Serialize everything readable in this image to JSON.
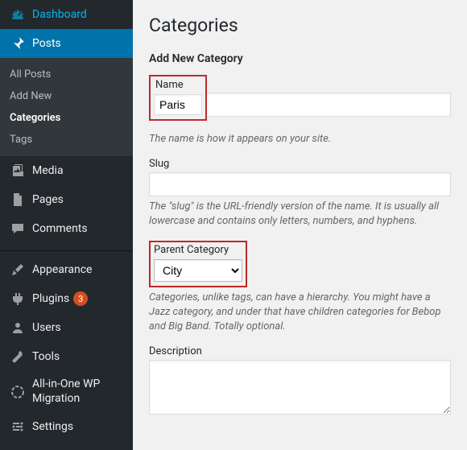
{
  "sidebar": {
    "dashboard": "Dashboard",
    "posts": "Posts",
    "posts_sub": {
      "all": "All Posts",
      "add": "Add New",
      "categories": "Categories",
      "tags": "Tags"
    },
    "media": "Media",
    "pages": "Pages",
    "comments": "Comments",
    "appearance": "Appearance",
    "plugins": "Plugins",
    "plugins_badge": "3",
    "users": "Users",
    "tools": "Tools",
    "aio": "All-in-One WP Migration",
    "settings": "Settings"
  },
  "page": {
    "title": "Categories",
    "heading": "Add New Category",
    "name_label": "Name",
    "name_value": "Paris",
    "name_desc": "The name is how it appears on your site.",
    "slug_label": "Slug",
    "slug_value": "",
    "slug_desc": "The \"slug\" is the URL-friendly version of the name. It is usually all lowercase and contains only letters, numbers, and hyphens.",
    "parent_label": "Parent Category",
    "parent_value": "City",
    "parent_desc": "Categories, unlike tags, can have a hierarchy. You might have a Jazz category, and under that have children categories for Bebop and Big Band. Totally optional.",
    "desc_label": "Description",
    "desc_value": ""
  }
}
